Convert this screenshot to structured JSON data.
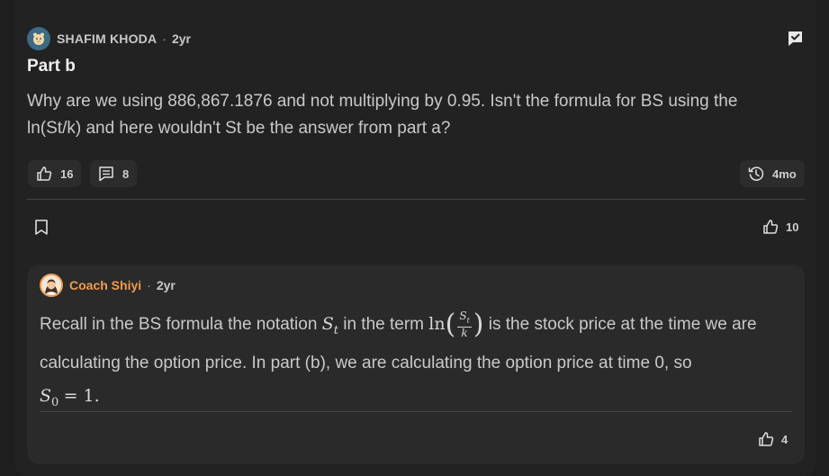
{
  "post": {
    "author": "SHAFIM KHODA",
    "separator": "·",
    "age": "2yr",
    "title": "Part b",
    "body": "Why are we using 886,867.1876 and not multiplying by 0.95. Isn't the formula for BS using the ln(St/k) and here wouldn't St be the answer from part a?",
    "upvotes": "16",
    "comments": "8",
    "last_activity": "4mo",
    "bookmark_icon": "bookmark-icon",
    "reply_upvotes": "10"
  },
  "reply": {
    "author": "Coach Shiyi",
    "separator": "·",
    "age": "2yr",
    "text_1": "Recall in the BS formula the notation",
    "sym_S": "S",
    "sym_t": "t",
    "text_2": "in the term",
    "ln": "ln",
    "frac_num_S": "S",
    "frac_num_t": "t",
    "frac_den": "k",
    "text_3": "is the stock price at the time we are calculating the option price. In part (b), we are calculating the option price at time 0, so",
    "sym_S0": "S",
    "sub_0": "0",
    "eq": "= 1.",
    "upvotes": "4"
  },
  "colors": {
    "background": "#1e1e1e",
    "card": "#222222",
    "reply_card": "#2a2a2a",
    "coach_accent": "#f39a4e",
    "text": "#c9c9c9"
  }
}
